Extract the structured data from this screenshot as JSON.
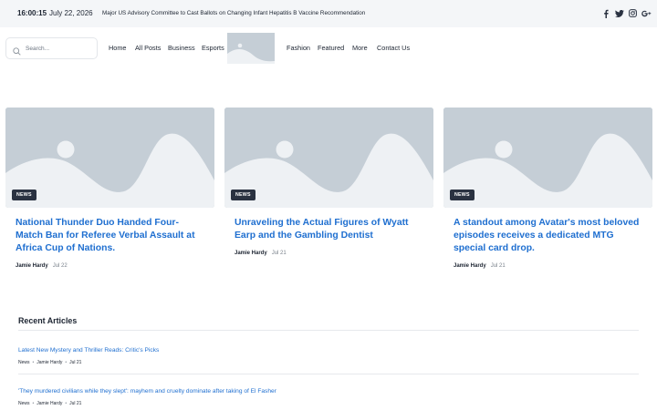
{
  "topbar": {
    "time": "16:00:15",
    "date": "July 22, 2026",
    "ticker": "Major US Advisory Committee to Cast Ballots on Changing Infant Hepatitis B Vaccine Recommendation",
    "social_icons": [
      "facebook-icon",
      "twitter-icon",
      "instagram-icon",
      "google-plus-icon"
    ]
  },
  "header": {
    "search_placeholder": "Search...",
    "nav_left": [
      "Home",
      "All Posts",
      "Business",
      "Esports"
    ],
    "nav_right": [
      "Fashion",
      "Featured",
      "More",
      "Contact Us"
    ]
  },
  "featured": [
    {
      "category": "NEWS",
      "title": "National Thunder Duo Handed Four-Match Ban for Referee Verbal Assault at Africa Cup of Nations.",
      "author": "Jamie Hardy",
      "date": "Jul 22"
    },
    {
      "category": "NEWS",
      "title": "Unraveling the Actual Figures of Wyatt Earp and the Gambling Dentist",
      "author": "Jamie Hardy",
      "date": "Jul 21"
    },
    {
      "category": "NEWS",
      "title": "A standout among Avatar's most beloved episodes receives a dedicated MTG special card drop.",
      "author": "Jamie Hardy",
      "date": "Jul 21"
    }
  ],
  "recent": {
    "heading": "Recent Articles",
    "articles": [
      {
        "title": "Latest New Mystery and Thriller Reads: Critic's Picks",
        "category": "News",
        "author": "Jamie Hardy",
        "date": "Jul 21"
      },
      {
        "title": "'They murdered civilians while they slept': mayhem and cruelty dominate after taking of El Fasher",
        "category": "News",
        "author": "Jamie Hardy",
        "date": "Jul 21"
      }
    ]
  },
  "colors": {
    "link_blue": "#1f6fd0",
    "dark_text": "#1c2431",
    "badge_bg": "#2a3241",
    "placeholder_image": "#c5ced6",
    "topbar_bg": "#f4f6f8"
  }
}
